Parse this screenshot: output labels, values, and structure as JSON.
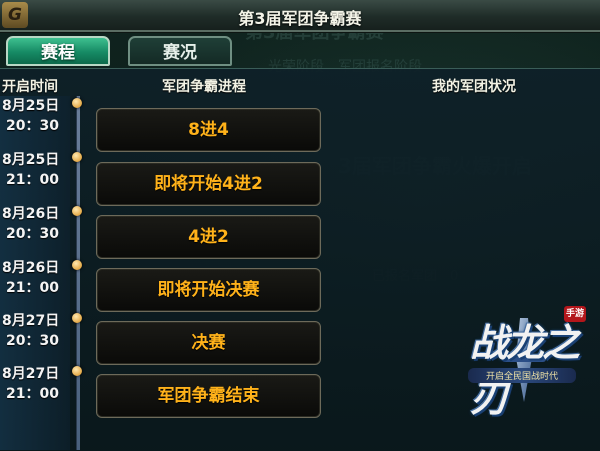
{
  "title": "第3届军团争霸赛",
  "title_ornament": "G",
  "tabs": [
    {
      "label": "赛程",
      "active": true
    },
    {
      "label": "赛况",
      "active": false
    }
  ],
  "columns": {
    "time": "开启时间",
    "progress": "军团争霸进程",
    "status": "我的军团状况"
  },
  "schedule": [
    {
      "date": "8月25日",
      "time": "20：30",
      "stage": "8进4"
    },
    {
      "date": "8月25日",
      "time": "21：00",
      "stage": "即将开始4进2"
    },
    {
      "date": "8月26日",
      "time": "20：30",
      "stage": "4进2"
    },
    {
      "date": "8月26日",
      "time": "21：00",
      "stage": "即将开始决赛"
    },
    {
      "date": "8月27日",
      "time": "20：30",
      "stage": "决赛"
    },
    {
      "date": "8月27日",
      "time": "21：00",
      "stage": "军团争霸结束"
    }
  ],
  "logo": {
    "name": "战龙之刃",
    "seal": "手游",
    "slogan": "开启全民国战时代"
  },
  "colors": {
    "stage_text": "#ffb21a",
    "tab_active": "#168a64",
    "timeline_dot": "#e3a845"
  }
}
